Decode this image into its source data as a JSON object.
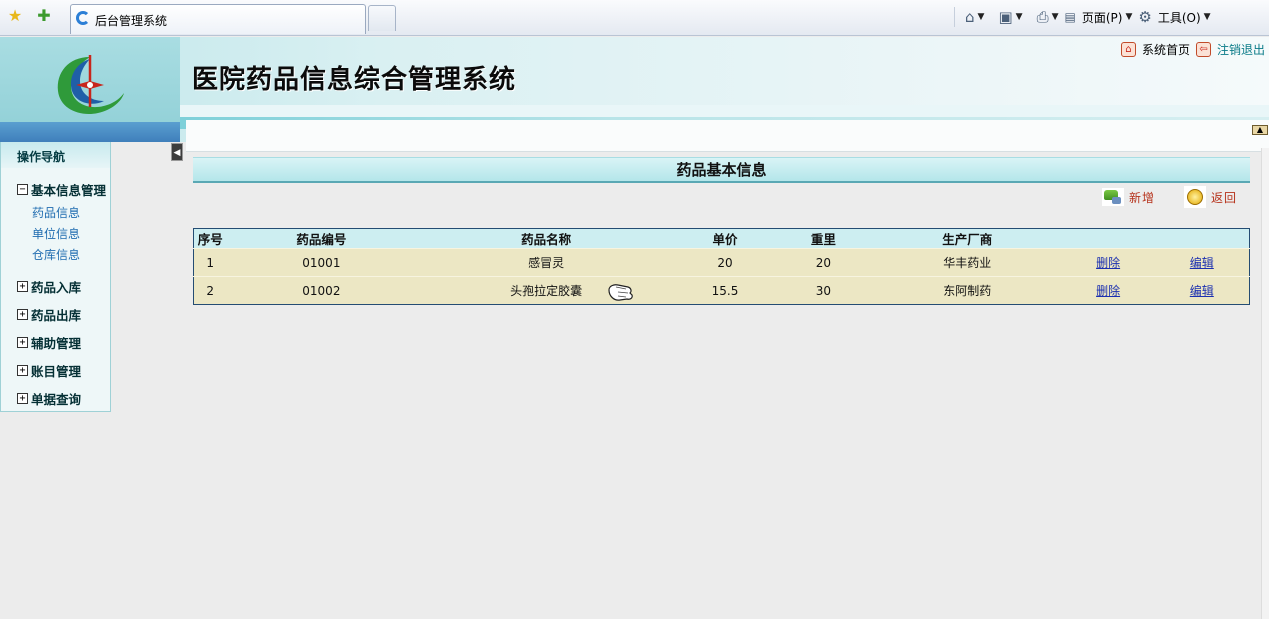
{
  "browser": {
    "tab_title": "后台管理系统",
    "page_menu": "页面(P)",
    "tools_menu": "工具(O)"
  },
  "header": {
    "system_title": "医院药品信息综合管理系统",
    "home_link": "系统首页",
    "logout_link": "注销退出"
  },
  "nav": {
    "title": "操作导航",
    "groups": [
      {
        "label": "基本信息管理",
        "expanded": true,
        "items": [
          "药品信息",
          "单位信息",
          "仓库信息"
        ]
      },
      {
        "label": "药品入库",
        "expanded": false
      },
      {
        "label": "药品出库",
        "expanded": false
      },
      {
        "label": "辅助管理",
        "expanded": false
      },
      {
        "label": "账目管理",
        "expanded": false
      },
      {
        "label": "单据查询",
        "expanded": false
      }
    ]
  },
  "main": {
    "panel_title": "药品基本信息",
    "actions": {
      "add": "新增",
      "back": "返回"
    },
    "table": {
      "headers": [
        "序号",
        "药品编号",
        "药品名称",
        "单价",
        "重里",
        "生产厂商",
        "",
        ""
      ],
      "rows": [
        {
          "no": "1",
          "code": "01001",
          "name": "感冒灵",
          "price": "20",
          "weight": "20",
          "maker": "华丰药业",
          "delete": "删除",
          "edit": "编辑"
        },
        {
          "no": "2",
          "code": "01002",
          "name": "头孢拉定胶囊",
          "price": "15.5",
          "weight": "30",
          "maker": "东阿制药",
          "delete": "删除",
          "edit": "编辑"
        }
      ]
    }
  },
  "colors": {
    "header_bg": "#bfe6ea",
    "table_body": "#ece7c4",
    "table_header": "#cdeef1",
    "link_blue": "#1b2fb0",
    "action_red": "#b6321b"
  }
}
